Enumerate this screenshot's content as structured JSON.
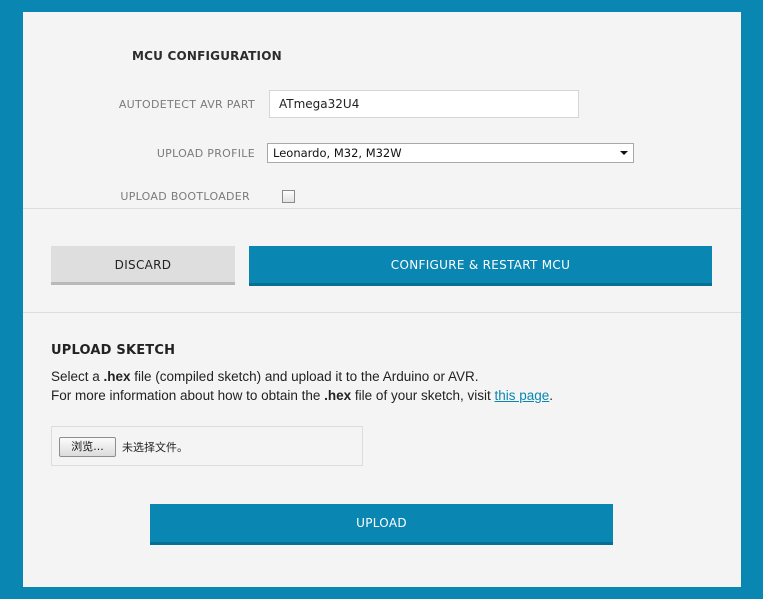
{
  "mcu_config": {
    "title": "MCU CONFIGURATION",
    "autodetect_label": "AUTODETECT AVR PART",
    "autodetect_value": "ATmega32U4",
    "profile_label": "UPLOAD PROFILE",
    "profile_selected": "Leonardo, M32, M32W",
    "bootloader_label": "UPLOAD BOOTLOADER",
    "bootloader_checked": false
  },
  "actions": {
    "discard_label": "DISCARD",
    "configure_label": "CONFIGURE & RESTART MCU"
  },
  "upload_sketch": {
    "title": "UPLOAD SKETCH",
    "line1_a": "Select a ",
    "line1_b": ".hex",
    "line1_c": " file (compiled sketch) and upload it to the Arduino or AVR.",
    "line2_a": "For more information about how to obtain the ",
    "line2_b": ".hex",
    "line2_c": " file of your sketch, visit ",
    "line2_link": "this page",
    "line2_end": ".",
    "file_button_label": "浏览...",
    "file_status": "未选择文件。",
    "upload_label": "UPLOAD"
  },
  "colors": {
    "accent": "#0a86b3",
    "panel_bg": "#f4f4f4"
  }
}
